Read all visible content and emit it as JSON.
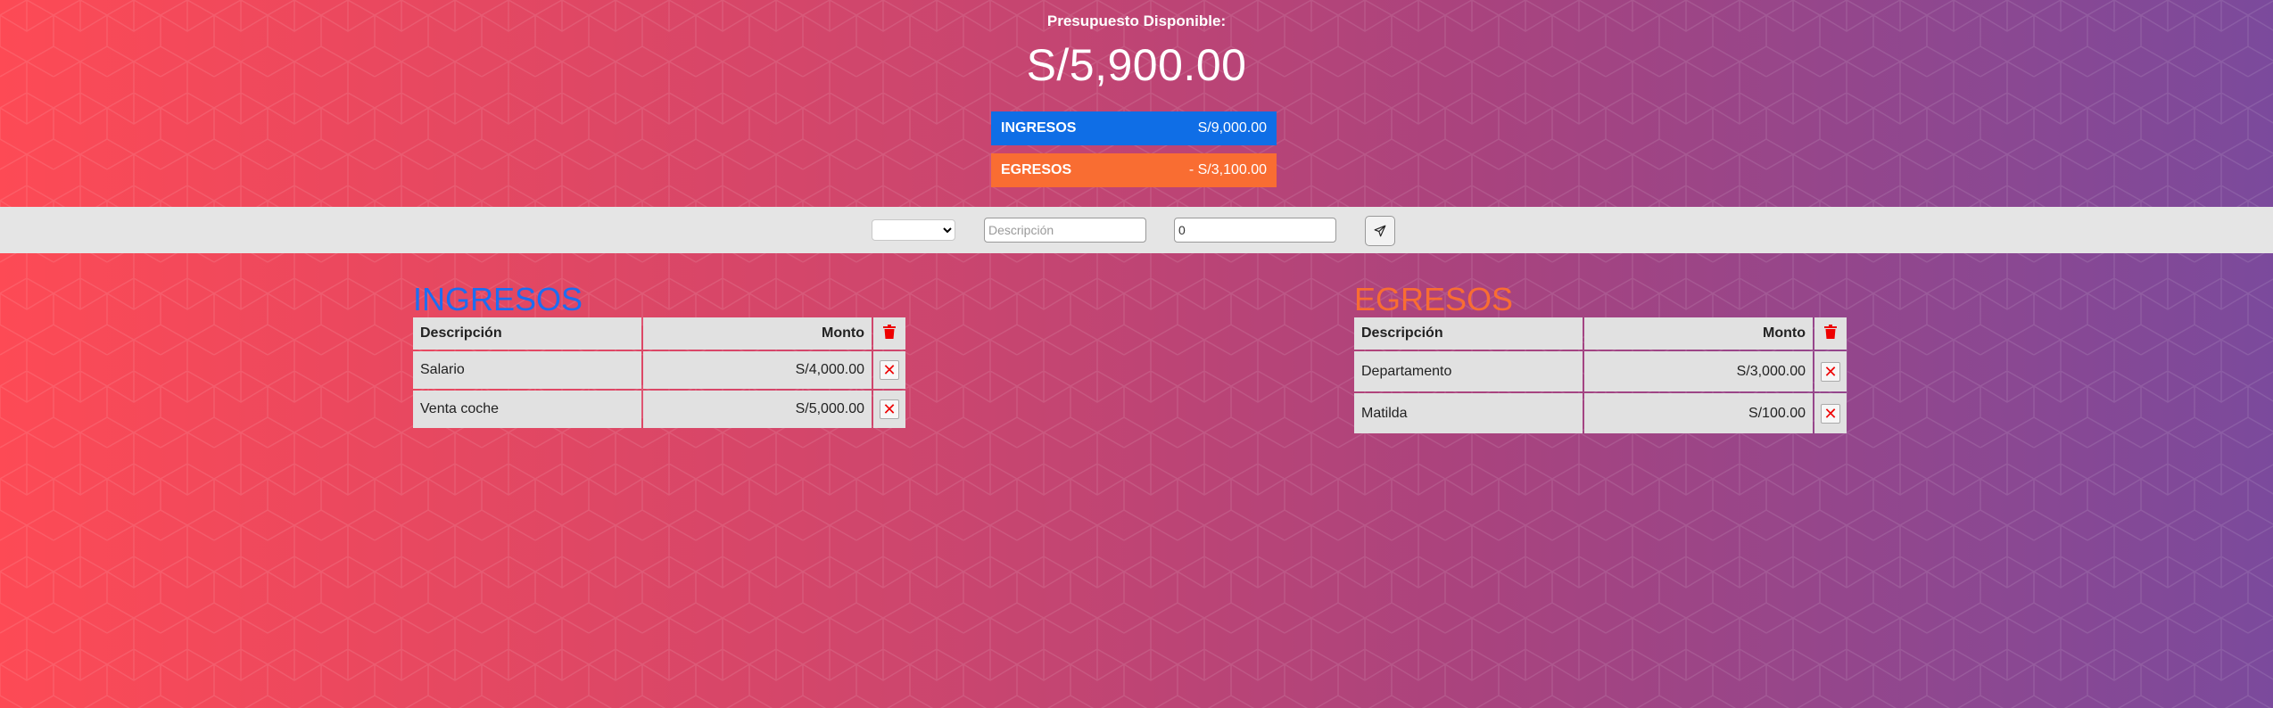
{
  "header": {
    "title": "Presupuesto Disponible:",
    "total": "S/5,900.00",
    "income_summary": {
      "label": "INGRESOS",
      "value": "S/9,000.00"
    },
    "expense_summary": {
      "label": "EGRESOS",
      "value": "- S/3,100.00"
    }
  },
  "form": {
    "type_select": {
      "selected": ""
    },
    "description": {
      "placeholder": "Descripción",
      "value": ""
    },
    "amount": {
      "placeholder": "0",
      "value": "0"
    },
    "submit_icon": "paper-plane-icon"
  },
  "ingresos": {
    "title": "INGRESOS",
    "columns": {
      "desc": "Descripción",
      "amount": "Monto"
    },
    "rows": [
      {
        "desc": "Salario",
        "amount": "S/4,000.00"
      },
      {
        "desc": "Venta coche",
        "amount": "S/5,000.00"
      }
    ]
  },
  "egresos": {
    "title": "EGRESOS",
    "columns": {
      "desc": "Descripción",
      "amount": "Monto"
    },
    "rows": [
      {
        "desc": "Departamento",
        "amount": "S/3,000.00"
      },
      {
        "desc": "Matilda",
        "amount": "S/100.00"
      }
    ]
  },
  "icons": {
    "delete_all": "trash-icon",
    "delete_row": "close-icon"
  },
  "colors": {
    "income": "#1d6df0",
    "expense": "#f96d32",
    "delete": "#e00000",
    "gradient_start": "#fd4a55",
    "gradient_end": "#7b4a9c"
  }
}
